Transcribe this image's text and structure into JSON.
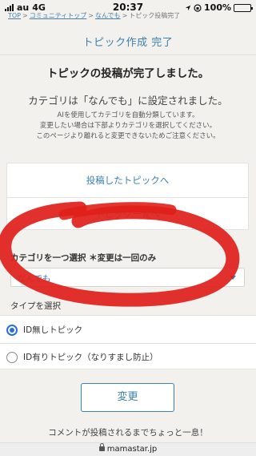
{
  "status_bar": {
    "carrier": "au",
    "network": "4G",
    "time": "20:37",
    "battery": "100%",
    "battery_level": 1.0
  },
  "breadcrumb": [
    {
      "label": "TOP"
    },
    {
      "label": "コミュニティトップ"
    },
    {
      "label": "なんでも"
    },
    {
      "label": "トピック投稿完了"
    }
  ],
  "page_title": "トピック作成 完了",
  "done_message": "トピックの投稿が完了しました。",
  "category_message": "カテゴリは「なんでも」に設定されました。",
  "notes": [
    "AIを使用してカテゴリを自動分類しています。",
    "変更したい場合は下部よりカテゴリを選択してください。",
    "このページより離れると変更できないためご注意ください。"
  ],
  "links": {
    "posted_topic": "投稿したトピックへ",
    "topic_list": "トピック一覧へ"
  },
  "category_select": {
    "label": "カテゴリを一つ選択 ＊変更は一回のみ",
    "value": "なんでも"
  },
  "type_select": {
    "label": "タイプを選択",
    "options": [
      {
        "label": "ID無しトピック",
        "checked": true
      },
      {
        "label": "ID有りトピック（なりすまし防止）",
        "checked": false
      }
    ]
  },
  "submit_label": "変更",
  "footer_text": "コメントが投稿されるまでちょっと一息！",
  "url": "mamastar.jp",
  "colors": {
    "accent": "#3b80ad",
    "radio": "#2a6fd6",
    "scribble": "#e0201a",
    "background": "#f3f1ee"
  }
}
